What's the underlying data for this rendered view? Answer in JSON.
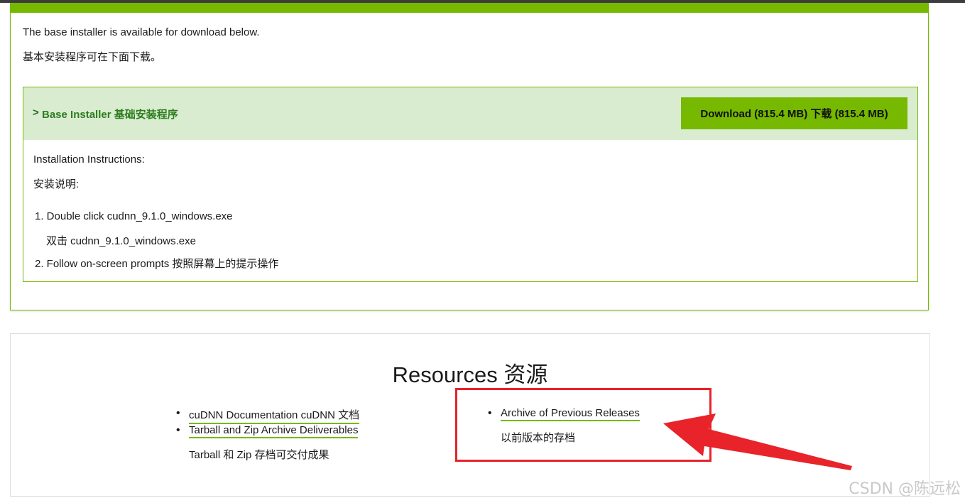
{
  "intro": {
    "line1": "The base installer is available for download below.",
    "line2": "基本安装程序可在下面下载。"
  },
  "installer": {
    "chevron": ">",
    "title": "Base Installer 基础安装程序",
    "download_label": "Download (815.4 MB)   下载 (815.4 MB)",
    "instructions_en": "Installation Instructions:",
    "instructions_cn": "安装说明:",
    "step1": "1. Double click cudnn_9.1.0_windows.exe",
    "step1_cn": "双击 cudnn_9.1.0_windows.exe",
    "step2": "2. Follow on-screen prompts 按照屏幕上的提示操作"
  },
  "resources": {
    "title": "Resources 资源",
    "links": {
      "docs": "cuDNN Documentation cuDNN 文档",
      "tarball": "Tarball and Zip Archive Deliverables",
      "tarball_cn": "Tarball 和 Zip 存档可交付成果",
      "archive": "Archive of Previous Releases",
      "archive_cn": "以前版本的存档"
    },
    "bullet": "•"
  },
  "watermark": "CSDN @陈远松",
  "colors": {
    "accent": "#76b900",
    "header_bg": "#d9ecd0",
    "annotation_red": "#e8232a"
  }
}
